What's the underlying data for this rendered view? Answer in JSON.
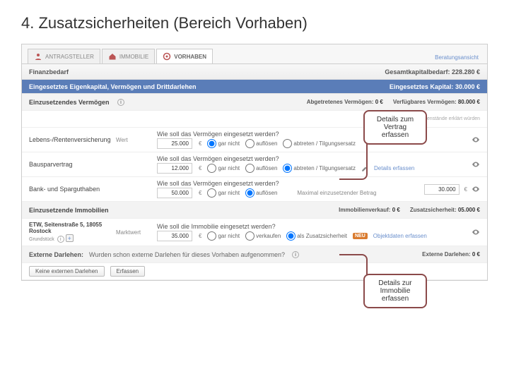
{
  "title": "4. Zusatzsicherheiten (Bereich Vorhaben)",
  "tabs": {
    "t1": "ANTRAGSTELLER",
    "t2": "IMMOBILIE",
    "t3": "VORHABEN",
    "rightLink": "Beratungsansicht"
  },
  "finanz": {
    "label": "Finanzbedarf",
    "gkLabel": "Gesamtkapitalbedarf:",
    "gkVal": "228.280 €"
  },
  "eigen": {
    "label": "Eingesetztes Eigenkapital, Vermögen und Drittdarlehen",
    "rightLabel": "Eingesetztes Kapital:",
    "rightVal": "30.000 €"
  },
  "einzVerm": {
    "label": "Einzusetzendes Vermögen",
    "abg": "Abgetretenes Vermögen:",
    "abgVal": "0 €",
    "ver": "Verfügbares Vermögen:",
    "verVal": "80.000 €",
    "note": "Weitere Vermögensgegenstände erklärt würden"
  },
  "lrv": {
    "label": "Lebens-/Rentenversicherung",
    "wert": "Wert",
    "wertVal": "25.000",
    "q": "Wie soll das Vermögen eingesetzt werden?",
    "r1": "gar nicht",
    "r2": "auflösen",
    "r3": "abtreten / Tilgungsersatz"
  },
  "bsv": {
    "label": "Bausparvertrag",
    "wertVal": "12.000",
    "q": "Wie soll das Vermögen eingesetzt werden?",
    "r1": "gar nicht",
    "r2": "auflösen",
    "r3": "abtreten / Tilgungsersatz",
    "details": "Details erfassen"
  },
  "bank": {
    "label": "Bank- und Sparguthaben",
    "wertVal": "50.000",
    "q": "Wie soll das Vermögen eingesetzt werden?",
    "r1": "gar nicht",
    "r2": "auflösen",
    "max": "Maximal einzusetzender Betrag",
    "maxVal": "30.000"
  },
  "immo": {
    "label": "Einzusetzende Immobilien",
    "verkauf": "Immobilienverkauf:",
    "verkaufVal": "0 €",
    "zusatz": "Zusatzsicherheit:",
    "zusatzVal": "05.000 €",
    "prop": "ETW, Seitenstraße 5, 18055 Rostock",
    "propSub": "Grundstück",
    "mw": "Marktwert",
    "mwVal": "35.000",
    "q": "Wie soll die Immobilie eingesetzt werden?",
    "r1": "gar nicht",
    "r2": "verkaufen",
    "r3": "als Zusatzsicherheit",
    "details": "Objektdaten erfassen"
  },
  "ext": {
    "label": "Externe Darlehen:",
    "q": "Wurden schon externe Darlehen für dieses Vorhaben aufgenommen?",
    "val": "Externe Darlehen:",
    "valNum": "0 €",
    "btn1": "Keine externen Darlehen",
    "btn2": "Erfassen"
  },
  "callouts": {
    "c1": "Details zum Vertrag erfassen",
    "c2": "Details zur Immobilie erfassen"
  }
}
